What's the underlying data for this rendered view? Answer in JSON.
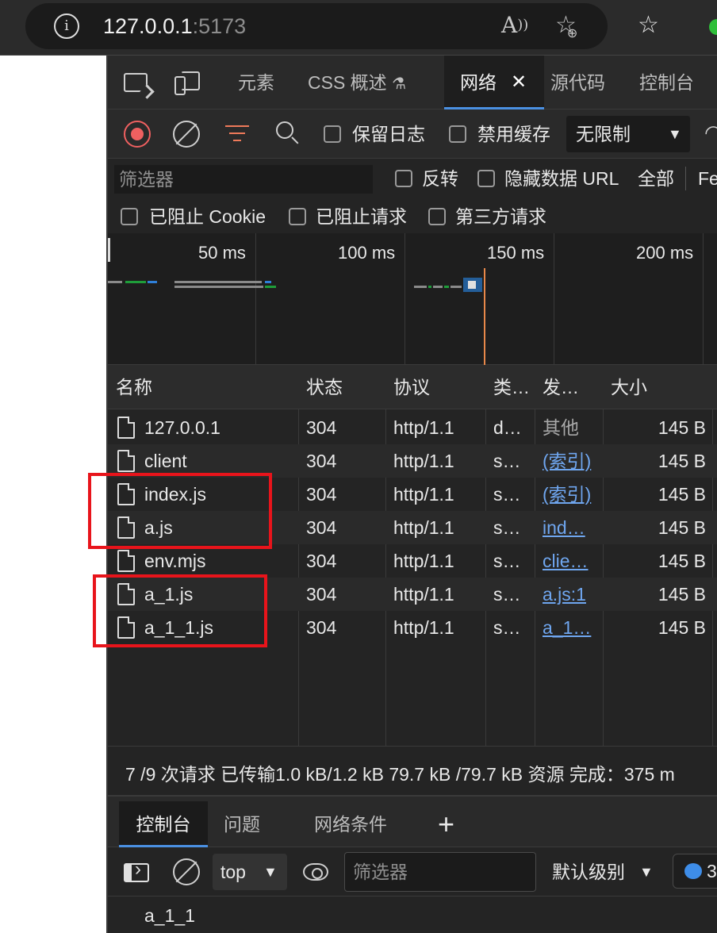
{
  "browser": {
    "url_host": "127.0.0.1",
    "url_port": ":5173",
    "icons": [
      "info-icon",
      "read-aloud-icon",
      "add-favorite-icon",
      "favorites-icon"
    ]
  },
  "devtools": {
    "tabs": {
      "elements": "元素",
      "css_overview": "CSS 概述",
      "network": "网络",
      "sources": "源代码",
      "console": "控制台"
    },
    "toolbar": {
      "preserve_log": "保留日志",
      "disable_cache": "禁用缓存",
      "throttling": "无限制"
    },
    "filter": {
      "placeholder": "筛选器",
      "invert": "反转",
      "hide_data_urls": "隐藏数据 URL",
      "all": "全部",
      "fetch_partial": "Fe",
      "blocked_cookies": "已阻止 Cookie",
      "blocked_requests": "已阻止请求",
      "third_party": "第三方请求"
    },
    "timeline": {
      "ticks": [
        "50 ms",
        "100 ms",
        "150 ms",
        "200 ms"
      ]
    },
    "table": {
      "headers": {
        "name": "名称",
        "status": "状态",
        "protocol": "协议",
        "type": "类…",
        "initiator": "发…",
        "size": "大小"
      },
      "rows": [
        {
          "name": "127.0.0.1",
          "status": "304",
          "protocol": "http/1.1",
          "type": "d…",
          "initiator": "其他",
          "size": "145 B"
        },
        {
          "name": "client",
          "status": "304",
          "protocol": "http/1.1",
          "type": "s…",
          "initiator": "(索引)",
          "size": "145 B"
        },
        {
          "name": "index.js",
          "status": "304",
          "protocol": "http/1.1",
          "type": "s…",
          "initiator": "(索引)",
          "size": "145 B"
        },
        {
          "name": "a.js",
          "status": "304",
          "protocol": "http/1.1",
          "type": "s…",
          "initiator": "ind…",
          "size": "145 B"
        },
        {
          "name": "env.mjs",
          "status": "304",
          "protocol": "http/1.1",
          "type": "s…",
          "initiator": "clie…",
          "size": "145 B"
        },
        {
          "name": "a_1.js",
          "status": "304",
          "protocol": "http/1.1",
          "type": "s…",
          "initiator": "a.js:1",
          "size": "145 B"
        },
        {
          "name": "a_1_1.js",
          "status": "304",
          "protocol": "http/1.1",
          "type": "s…",
          "initiator": "a_1…",
          "size": "145 B"
        }
      ]
    },
    "summary": "7 /9 次请求  已传输1.0 kB/1.2 kB  79.7 kB /79.7 kB 资源  完成：375 m",
    "drawer": {
      "tabs": {
        "console": "控制台",
        "issues": "问题",
        "network_conditions": "网络条件",
        "add": "+"
      },
      "context": "top",
      "filter_placeholder": "筛选器",
      "level": "默认级别",
      "issues_count": "3",
      "output_line": "a_1_1"
    }
  },
  "colors": {
    "accent": "#4a90e2",
    "record": "#ef6060",
    "annotation": "#e8141b",
    "link": "#6fa6ef"
  }
}
